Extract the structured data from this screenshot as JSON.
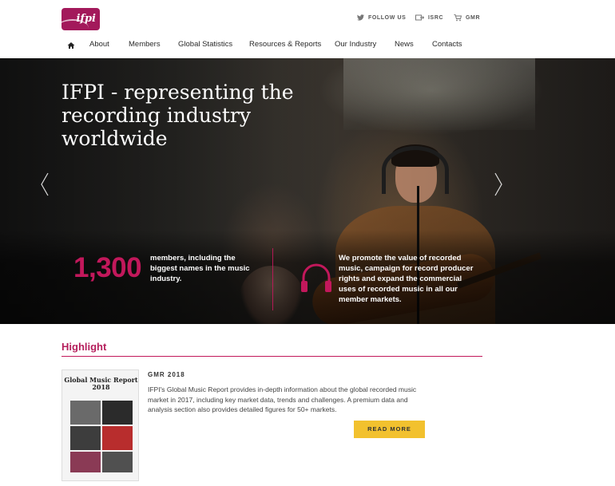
{
  "brand": {
    "logo_text": "ifpi",
    "accent_color": "#a3195b",
    "highlight_color": "#c2185b",
    "button_color": "#f2c12e"
  },
  "utility_nav": {
    "follow_us": "FOLLOW US",
    "isrc": "ISRC",
    "gmr": "GMR",
    "icons": [
      "twitter-icon",
      "isrc-icon",
      "cart-icon"
    ]
  },
  "main_nav": {
    "home_icon": "home-icon",
    "items": [
      "About",
      "Members",
      "Global Statistics",
      "Resources & Reports",
      "Our Industry",
      "News",
      "Contacts"
    ]
  },
  "hero": {
    "title": "IFPI - representing the recording industry worldwide",
    "stat_number": "1,300",
    "stat_text": "members, including the biggest names in the music industry.",
    "promo_text": "We promote the value of recorded music, campaign for record producer rights and expand the commercial uses of recorded music in all our member markets.",
    "prev_icon": "chevron-left-icon",
    "next_icon": "chevron-right-icon",
    "promo_icon": "headphones-icon"
  },
  "highlight": {
    "section_title": "Highlight",
    "cover_title": "Global Music Report 2018",
    "item_label": "GMR 2018",
    "item_text": "IFPI's Global Music Report provides in-depth information about the global recorded music market in 2017, including key market data, trends and challenges. A premium data and analysis section also provides detailed figures for 50+ markets.",
    "button_label": "READ MORE"
  }
}
